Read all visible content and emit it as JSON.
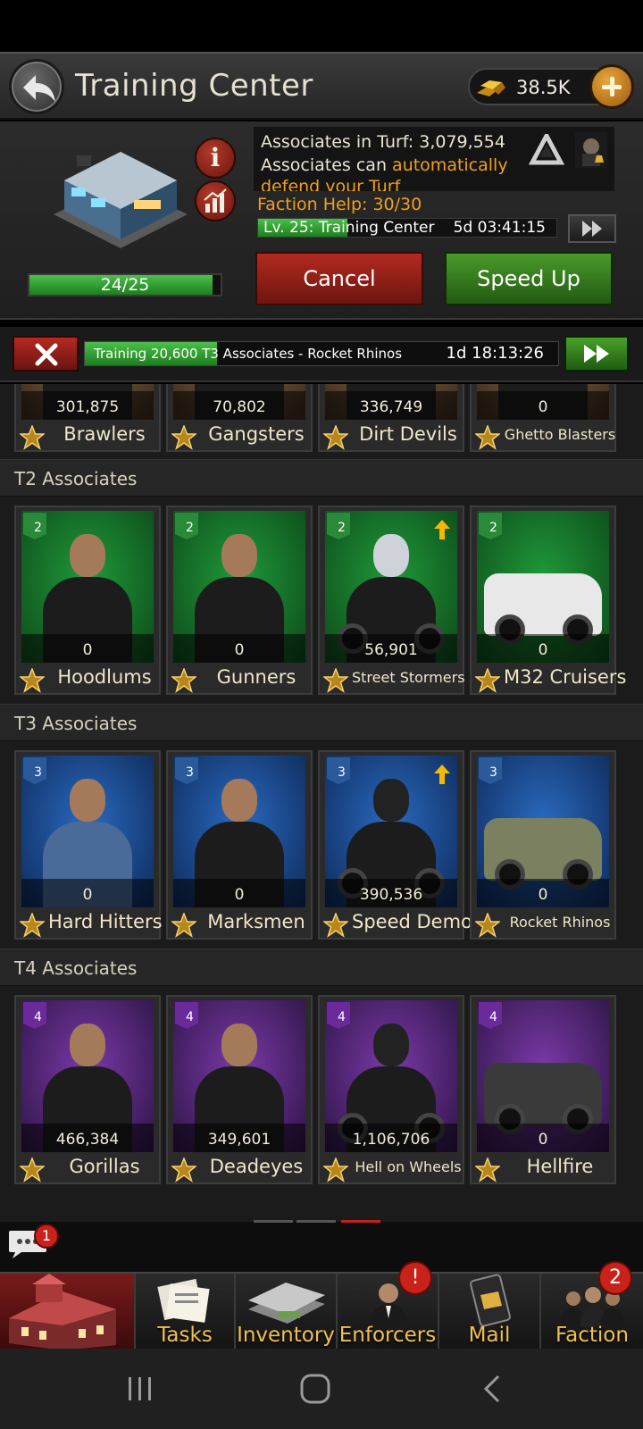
{
  "header": {
    "title": "Training Center",
    "gold": "38.5K"
  },
  "building": {
    "level_progress": "24/25",
    "level_fraction": 0.96,
    "turf_line1": "Associates in Turf: 3,079,554",
    "turf_line2_prefix": "Associates can ",
    "turf_line2_highlight": "automatically",
    "turf_line3": "defend your Turf",
    "faction_help": "Faction Help: 30/30",
    "upgrade_label": "Lv. 25: Training Center",
    "upgrade_time": "5d 03:41:15",
    "cancel_label": "Cancel",
    "speedup_label": "Speed Up"
  },
  "queue": {
    "label": "Training 20,600 T3 Associates - Rocket Rhinos",
    "time": "1d 18:13:26"
  },
  "t1_units": [
    {
      "name": "Brawlers",
      "count": "301,875"
    },
    {
      "name": "Gangsters",
      "count": "70,802"
    },
    {
      "name": "Dirt Devils",
      "count": "336,749"
    },
    {
      "name": "Ghetto Blasters",
      "count": "0"
    }
  ],
  "sections": {
    "t2": "T2 Associates",
    "t3": "T3 Associates",
    "t4": "T4 Associates"
  },
  "t2_units": [
    {
      "name": "Hoodlums",
      "count": "0",
      "tier": "2"
    },
    {
      "name": "Gunners",
      "count": "0",
      "tier": "2"
    },
    {
      "name": "Street Stormers",
      "count": "56,901",
      "tier": "2"
    },
    {
      "name": "M32 Cruisers",
      "count": "0",
      "tier": "2"
    }
  ],
  "t3_units": [
    {
      "name": "Hard Hitters",
      "count": "0",
      "tier": "3"
    },
    {
      "name": "Marksmen",
      "count": "0",
      "tier": "3"
    },
    {
      "name": "Speed Demons",
      "count": "390,536",
      "tier": "3"
    },
    {
      "name": "Rocket Rhinos",
      "count": "0",
      "tier": "3"
    }
  ],
  "t4_units": [
    {
      "name": "Gorillas",
      "count": "466,384",
      "tier": "4"
    },
    {
      "name": "Deadeyes",
      "count": "349,601",
      "tier": "4"
    },
    {
      "name": "Hell on Wheels",
      "count": "1,106,706",
      "tier": "4"
    },
    {
      "name": "Hellfire",
      "count": "0",
      "tier": "4"
    }
  ],
  "chat": {
    "badge": "1"
  },
  "nav": {
    "tasks": "Tasks",
    "inventory": "Inventory",
    "enforcers": "Enforcers",
    "enforcers_badge": "!",
    "mail": "Mail",
    "faction": "Faction",
    "faction_badge": "2"
  },
  "colors": {
    "accent_orange": "#f0a01c",
    "progress_green": "#3aa83a",
    "cancel_red": "#9a2018",
    "speedup_green": "#3a7a1e",
    "t2_bg": "#1f9a3a",
    "t3_bg": "#2a6ac0",
    "t4_bg": "#7a3aa8"
  }
}
